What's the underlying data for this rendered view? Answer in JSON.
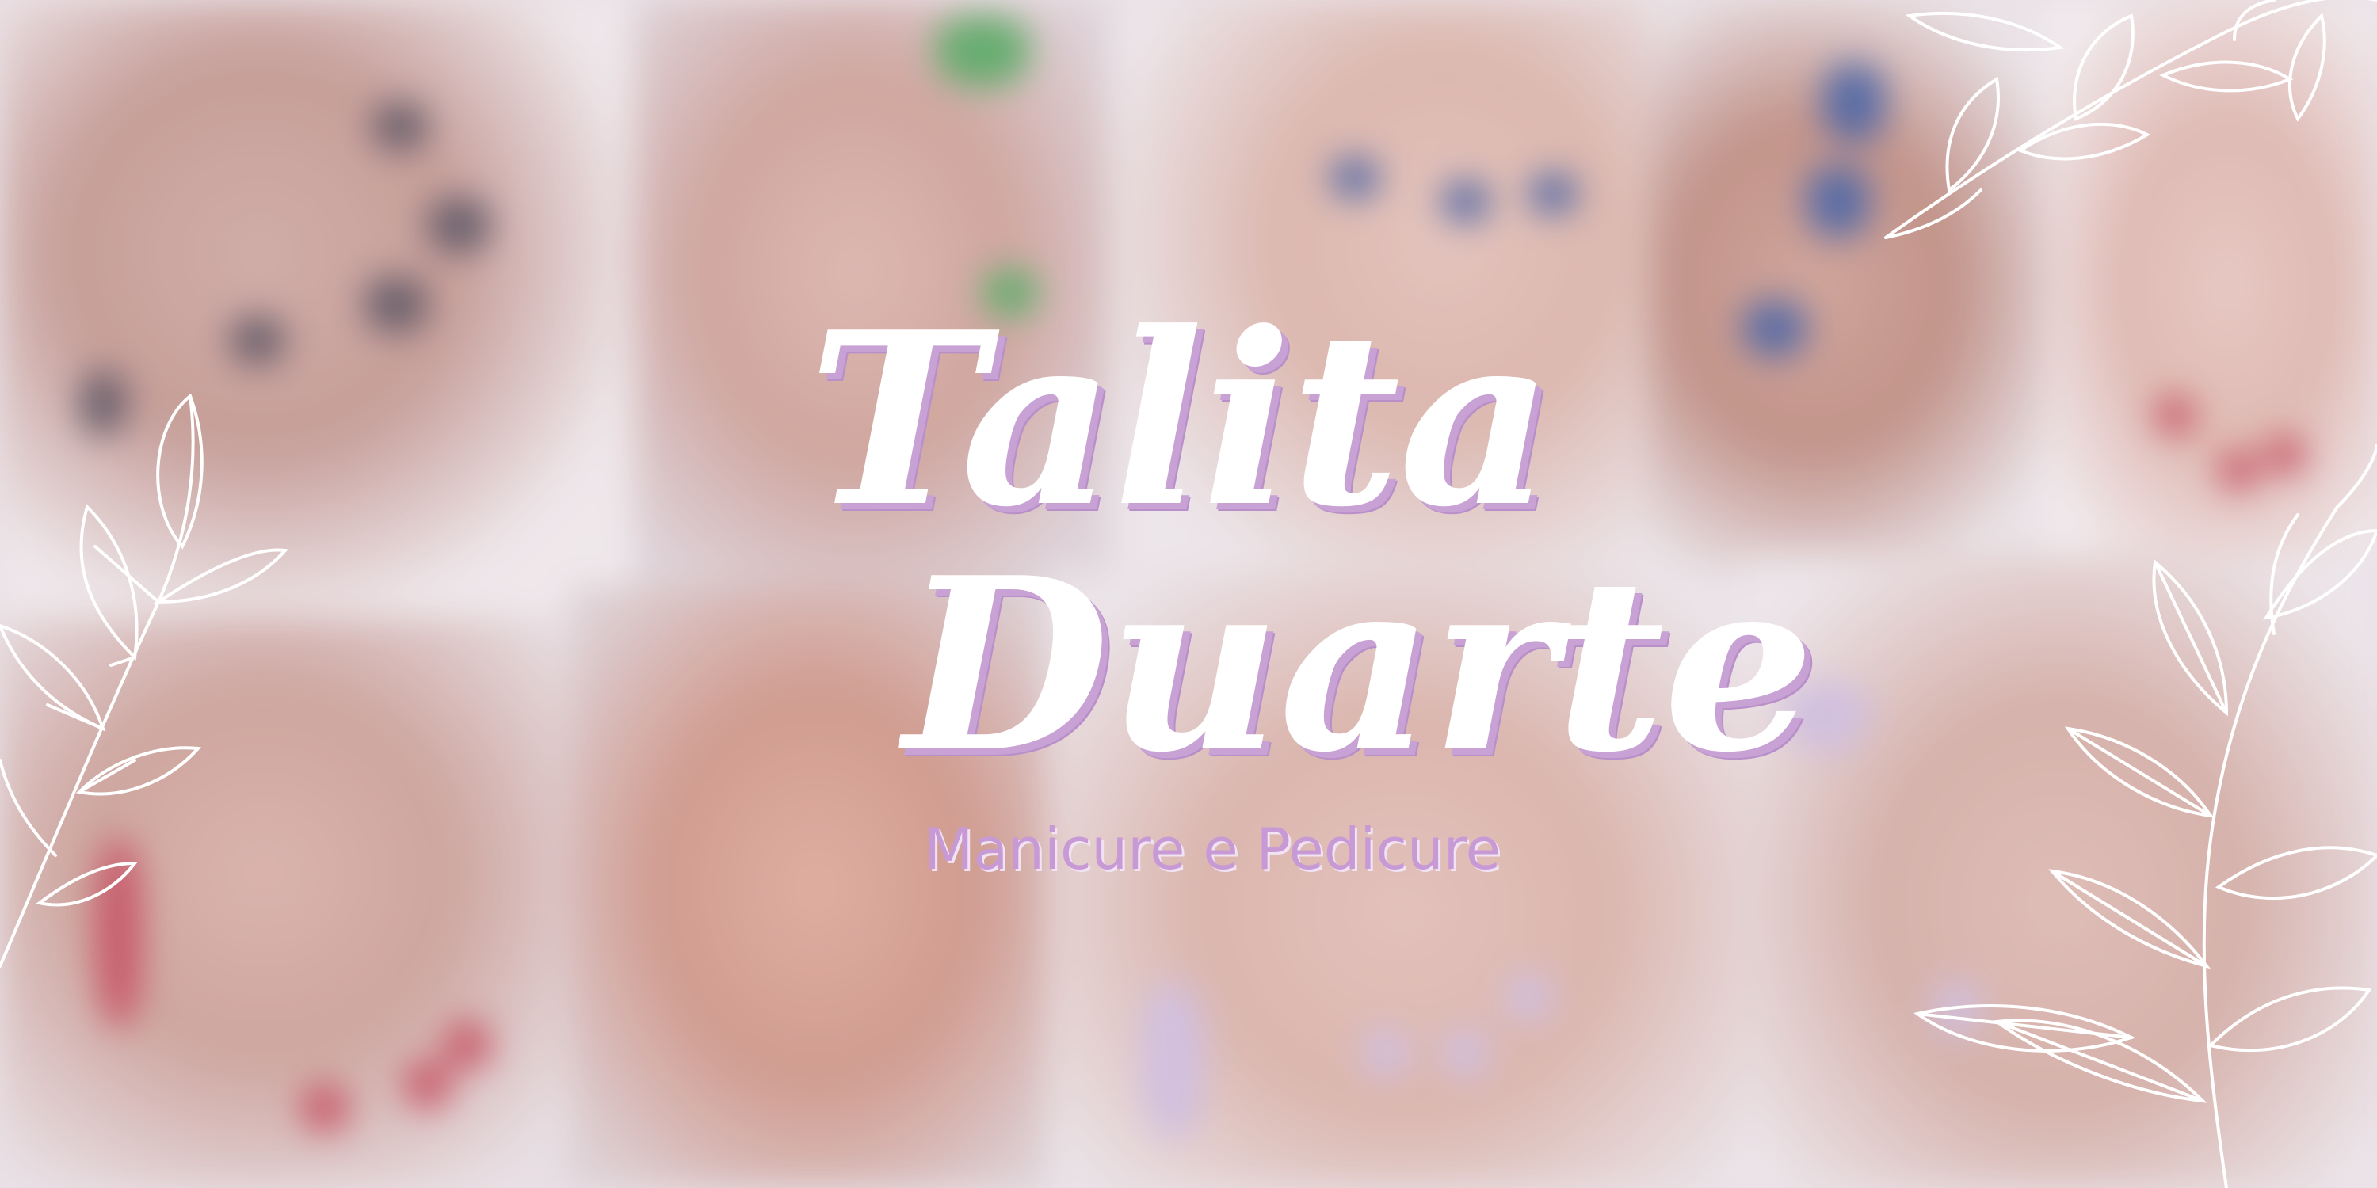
{
  "banner": {
    "name_line1": "Talita",
    "name_line2": "Duarte",
    "subtitle": "Manicure e Pedicure"
  },
  "colors": {
    "title_fill": "#ffffff",
    "title_shadow": "#c8a2d4",
    "subtitle": "#c79ad6",
    "leaf_outline": "#ffffff"
  },
  "decorations": {
    "background": "blurred-nail-photo-collage",
    "left_ornament": "leaf-branch-icon",
    "top_right_ornament": "leaf-branch-icon",
    "bottom_right_ornament": "leaf-branch-icon"
  }
}
